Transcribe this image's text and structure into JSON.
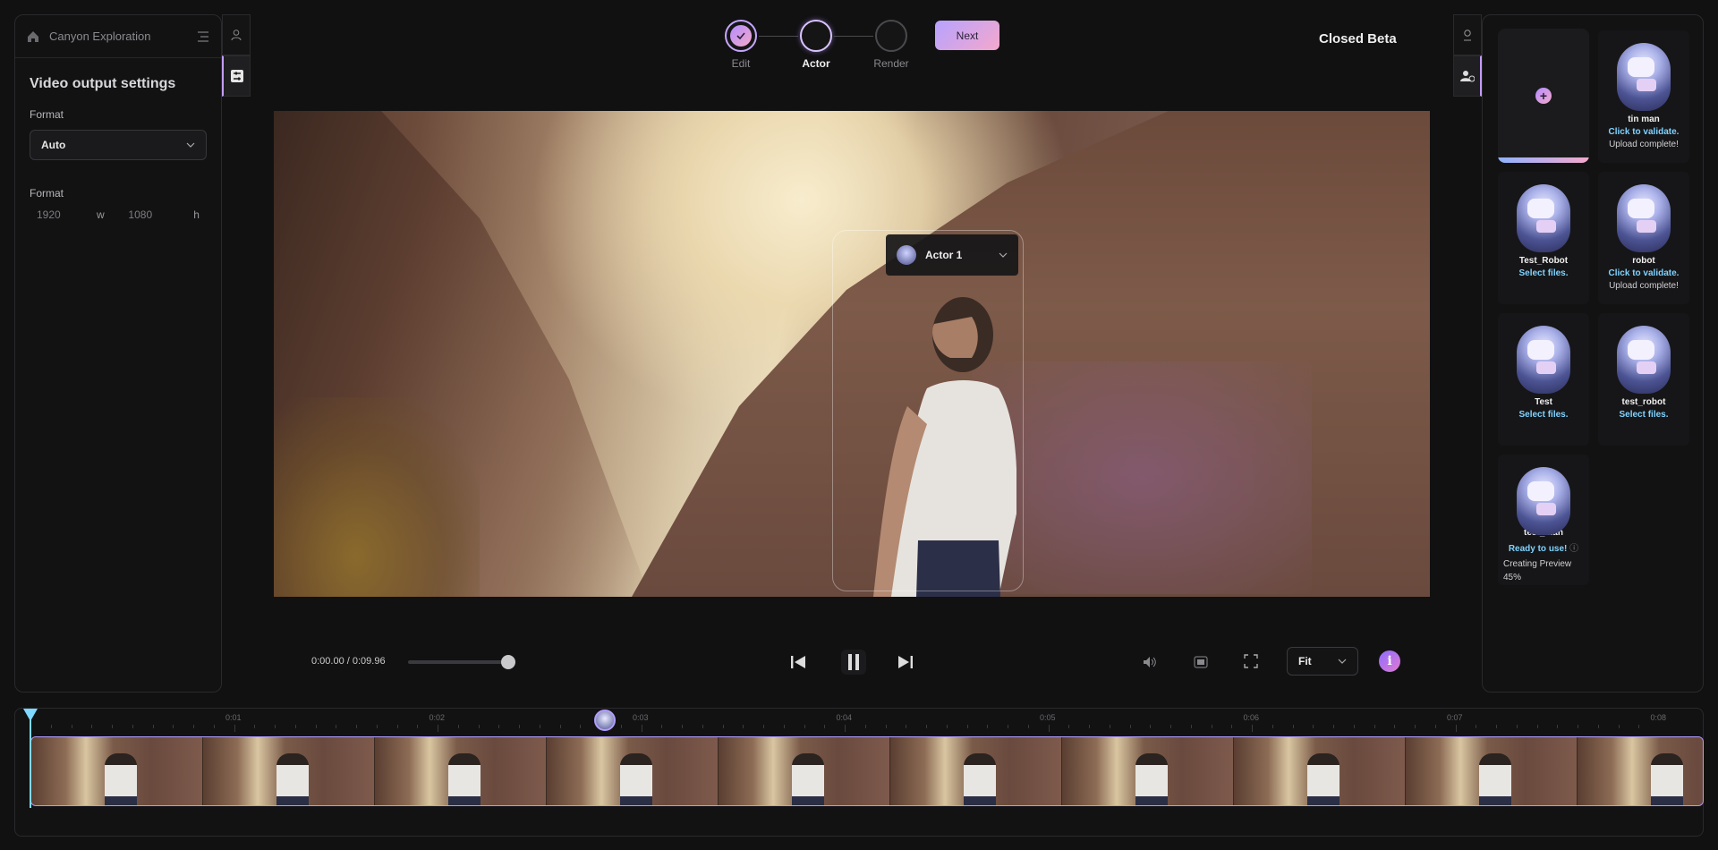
{
  "project": {
    "name": "Canyon Exploration"
  },
  "left_panel": {
    "title": "Video output settings",
    "format_label": "Format",
    "format_value": "Auto",
    "size_label": "Format",
    "width": "1920",
    "width_unit": "w",
    "height": "1080",
    "height_unit": "h"
  },
  "stepper": {
    "steps": [
      {
        "label": "Edit",
        "state": "done"
      },
      {
        "label": "Actor",
        "state": "active"
      },
      {
        "label": "Render",
        "state": "pending"
      }
    ],
    "next_label": "Next"
  },
  "badge": "Closed Beta",
  "video": {
    "actor_label": "Actor 1"
  },
  "controls": {
    "time": "0:00.00 / 0:09.96",
    "zoom": "Fit",
    "info": "i"
  },
  "actors": [
    {
      "name": "tin man",
      "status": "Click to validate.",
      "status2": "Upload complete!"
    },
    {
      "name": "Test_Robot",
      "status": "Select files."
    },
    {
      "name": "robot",
      "status": "Click to validate.",
      "status2": "Upload complete!"
    },
    {
      "name": "Test",
      "status": "Select files."
    },
    {
      "name": "test_robot",
      "status": "Select files."
    },
    {
      "name": "test_man",
      "status": "Ready to use!",
      "status2": "Creating Preview",
      "progress": "45%"
    }
  ],
  "timeline": {
    "ticks": [
      "0:01",
      "0:02",
      "0:03",
      "0:04",
      "0:05",
      "0:06",
      "0:07",
      "0:08"
    ]
  },
  "colors": {
    "accent_gradient_start": "#b48cff",
    "accent_gradient_end": "#f5a8cc",
    "status_blue": "#7fd3ff",
    "playhead": "#7fd8ff"
  }
}
